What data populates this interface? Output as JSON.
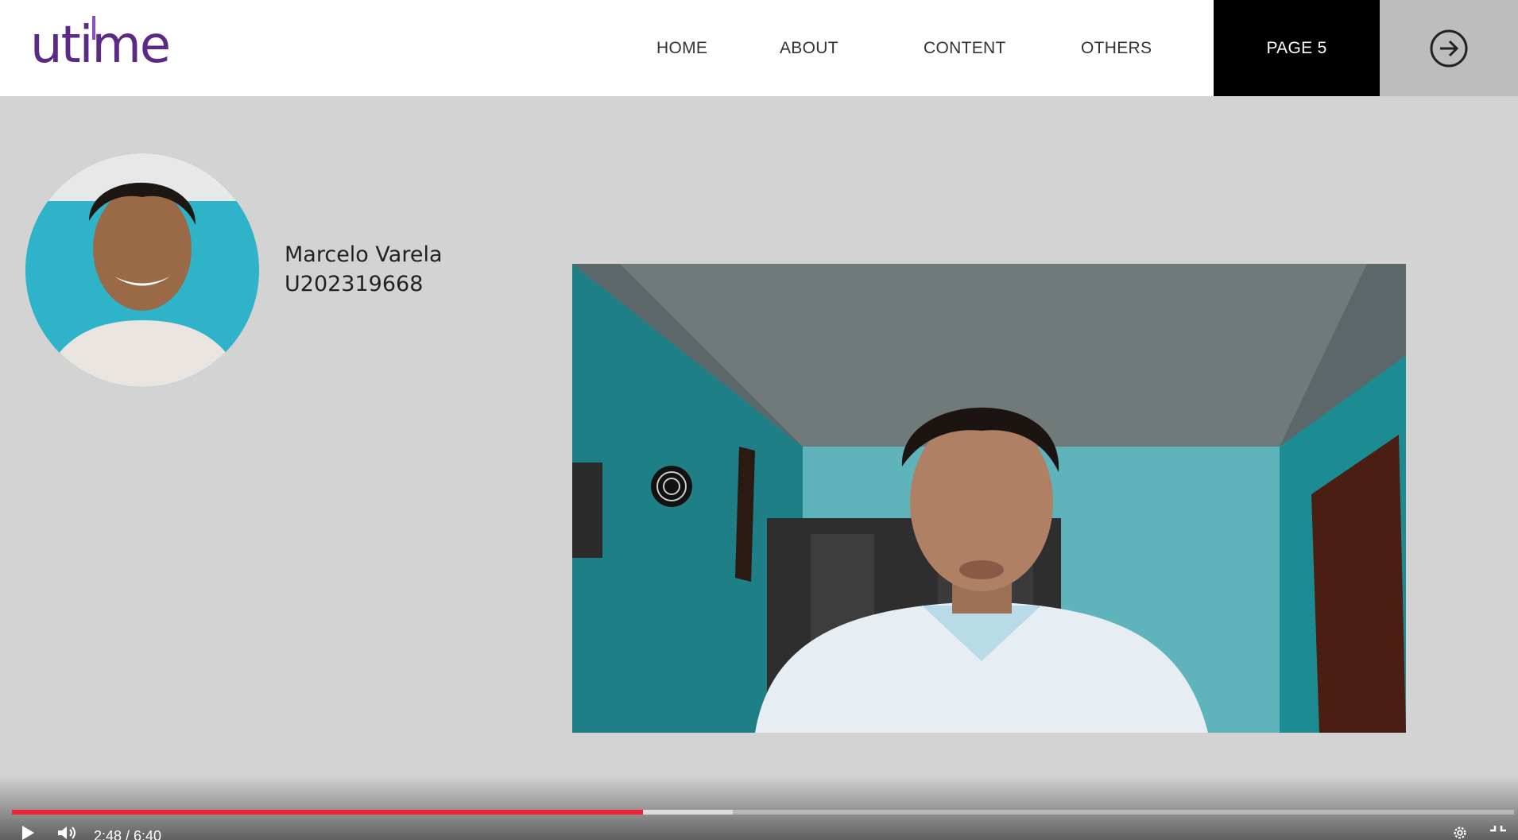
{
  "header": {
    "logo_text": "utime",
    "nav": [
      {
        "label": "HOME"
      },
      {
        "label": "ABOUT"
      },
      {
        "label": "CONTENT"
      },
      {
        "label": "OTHERS"
      },
      {
        "label": "PAGE 5",
        "active": true
      }
    ],
    "next_icon": "arrow-right-circle-icon"
  },
  "profile": {
    "name": "Marcelo Varela",
    "student_id": "U202319668"
  },
  "player": {
    "time_display": "2:48 / 6:40",
    "progress_fraction": 0.42,
    "buffered_fraction": 0.4797,
    "icons": [
      "play-icon",
      "volume-icon",
      "settings-icon",
      "fullscreen-exit-icon"
    ]
  },
  "colors": {
    "brand": "#5b2a86",
    "progress": "#f0203a",
    "active_nav_bg": "#000000",
    "page_bg": "#d3d3d3"
  }
}
